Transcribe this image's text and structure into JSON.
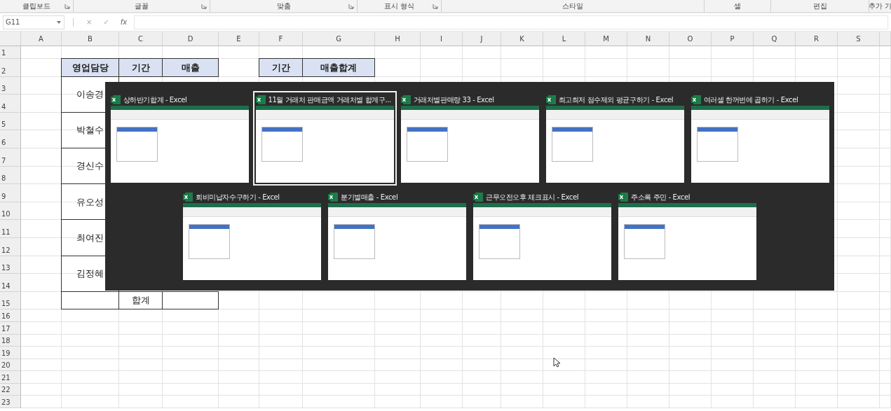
{
  "ribbon_groups": [
    {
      "label": "클립보드",
      "launcher": true
    },
    {
      "label": "글꼴",
      "launcher": true
    },
    {
      "label": "맞춤",
      "launcher": true
    },
    {
      "label": "표시 형식",
      "launcher": true
    },
    {
      "label": "스타일",
      "launcher": false
    },
    {
      "label": "셀",
      "launcher": false
    },
    {
      "label": "편집",
      "launcher": false
    },
    {
      "label": "추가 기",
      "launcher": false
    }
  ],
  "formula_bar": {
    "name_box": "G11",
    "buttons": [
      "×",
      "✓",
      "fx"
    ]
  },
  "sheet": {
    "columns": [
      "A",
      "B",
      "C",
      "D",
      "E",
      "F",
      "G",
      "H",
      "I",
      "J",
      "K",
      "L",
      "M",
      "N",
      "O",
      "P",
      "Q",
      "R",
      "S"
    ],
    "rows": [
      {
        "number": "1",
        "cells": []
      },
      {
        "number": "2",
        "cells": [
          "",
          {
            "text": "영업담당",
            "kind": "header"
          },
          {
            "text": "기간",
            "kind": "header"
          },
          {
            "text": "매출",
            "kind": "header"
          },
          "",
          {
            "text": "기간",
            "kind": "header"
          },
          {
            "text": "매출합계",
            "kind": "header"
          }
        ]
      },
      {
        "number": "3",
        "cells": [
          "",
          {
            "text": "이송경",
            "kind": "body",
            "merged_down": true
          }
        ]
      },
      {
        "number": "4",
        "cells": []
      },
      {
        "number": "5",
        "cells": [
          "",
          {
            "text": "박철수",
            "kind": "body",
            "merged_down": true
          }
        ]
      },
      {
        "number": "6",
        "cells": []
      },
      {
        "number": "7",
        "cells": [
          "",
          {
            "text": "경신수",
            "kind": "body",
            "merged_down": true
          }
        ]
      },
      {
        "number": "8",
        "cells": []
      },
      {
        "number": "9",
        "cells": [
          "",
          {
            "text": "유오성",
            "kind": "body",
            "merged_down": true
          }
        ]
      },
      {
        "number": "10",
        "cells": []
      },
      {
        "number": "11",
        "cells": [
          "",
          {
            "text": "최여진",
            "kind": "body",
            "merged_down": true
          }
        ]
      },
      {
        "number": "12",
        "cells": []
      },
      {
        "number": "13",
        "cells": [
          "",
          {
            "text": "김정혜",
            "kind": "body",
            "merged_down": true
          }
        ]
      },
      {
        "number": "14",
        "cells": []
      },
      {
        "number": "15",
        "cells": [
          "",
          {
            "kind": "body"
          },
          {
            "text": "합계",
            "kind": "body"
          },
          {
            "kind": "body"
          }
        ]
      },
      {
        "number": "16",
        "cells": []
      },
      {
        "number": "17",
        "cells": []
      },
      {
        "number": "18",
        "cells": []
      },
      {
        "number": "19",
        "cells": []
      },
      {
        "number": "20",
        "cells": []
      },
      {
        "number": "21",
        "cells": []
      },
      {
        "number": "22",
        "cells": []
      },
      {
        "number": "23",
        "cells": []
      }
    ]
  },
  "task_switcher": {
    "rows": [
      [
        {
          "title": "상하반기합계 - Excel",
          "selected": false
        },
        {
          "title": "11월 거래처 판매금액 거래처별 합계구...",
          "selected": true
        },
        {
          "title": "거래처별판매량 33 - Excel",
          "selected": false
        },
        {
          "title": "최고최저 점수제외 평균구하기 - Excel",
          "selected": false
        },
        {
          "title": "여러셀 한꺼번에 곱하기 - Excel",
          "selected": false
        }
      ],
      [
        {
          "title": "회비미납자수구하기 - Excel",
          "selected": false
        },
        {
          "title": "분기별매출 - Excel",
          "selected": false
        },
        {
          "title": "근무오전오후 체크표시 - Excel",
          "selected": false
        },
        {
          "title": "주소록 주민 - Excel",
          "selected": false
        }
      ]
    ]
  }
}
